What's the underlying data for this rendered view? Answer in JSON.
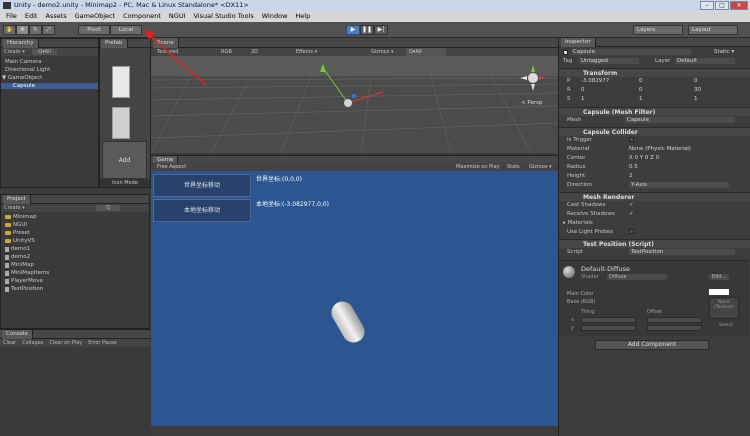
{
  "window": {
    "title": "Unity - demo2.unity - Minimap2 - PC, Mac & Linux Standalone* <DX11>",
    "minimize": "–",
    "maximize": "□",
    "close": "✕"
  },
  "menu": [
    "File",
    "Edit",
    "Assets",
    "GameObject",
    "Component",
    "NGUI",
    "Visual Studio Tools",
    "Window",
    "Help"
  ],
  "toolbar": {
    "pivot": "Pivot",
    "local": "Local",
    "play": "▶",
    "pause": "❚❚",
    "step": "▶|",
    "layers": "Layers",
    "layout": "Layout"
  },
  "hierarchy": {
    "tab": "Hierarchy",
    "create": "Create ▾",
    "search": "Q▾All",
    "items": [
      "Main Camera",
      "Directional Light",
      "▼ GameObject",
      "Capsule"
    ]
  },
  "prefab": {
    "tab": "Prefab",
    "add": "Add",
    "mode": "Icon Mode"
  },
  "scene": {
    "tab": "Scene",
    "shading": "Textured",
    "rgb": "RGB",
    "mode_2d": "2D",
    "effects": "Effects ▾",
    "gizmos": "Gizmos ▾",
    "search": "Q▾All",
    "persp": "< Persp"
  },
  "game": {
    "tab": "Game",
    "aspect": "Free Aspect",
    "max_on_play": "Maximize on Play",
    "stats": "Stats",
    "gizmos": "Gizmos ▾",
    "btn_world": "世界坐标移动",
    "btn_local": "本地坐标移动",
    "text_world": "世界坐标:(0,0,0)",
    "text_local": "本地坐标:(-3.082977,0,0)"
  },
  "project": {
    "tab": "Project",
    "create": "Create ▾",
    "search": "Q",
    "folders": [
      "Minimap",
      "NGUI",
      "Preset",
      "UnityVS"
    ],
    "files": [
      "demo1",
      "demo2",
      "MiniMap",
      "MiniMapItems",
      "PlayerMove",
      "TestPosition"
    ]
  },
  "console": {
    "tab": "Console",
    "clear": "Clear",
    "collapse": "Collapse",
    "clear_on_play": "Clear on Play",
    "error_pause": "Error Pause"
  },
  "inspector": {
    "tab": "Inspector",
    "name": "Capsule",
    "static": "Static ▾",
    "tag_label": "Tag",
    "tag": "Untagged",
    "layer_label": "Layer",
    "layer": "Default",
    "transform": {
      "title": "Transform",
      "position": {
        "label": "P",
        "x": "-3.082977",
        "y": "0",
        "z": "0"
      },
      "rotation": {
        "label": "R",
        "x": "0",
        "y": "0",
        "z": "30"
      },
      "scale": {
        "label": "S",
        "x": "1",
        "y": "1",
        "z": "1"
      }
    },
    "mesh_filter": {
      "title": "Capsule (Mesh Filter)",
      "mesh_label": "Mesh",
      "mesh": "Capsule"
    },
    "collider": {
      "title": "Capsule Collider",
      "rows": [
        {
          "label": "Is Trigger",
          "value": ""
        },
        {
          "label": "Material",
          "value": "None (Physic Material)"
        },
        {
          "label": "Center",
          "value": "X 0     Y 0     Z 0"
        },
        {
          "label": "Radius",
          "value": "0.5"
        },
        {
          "label": "Height",
          "value": "2"
        },
        {
          "label": "Direction",
          "value": "Y-Axis"
        }
      ]
    },
    "renderer": {
      "title": "Mesh Renderer",
      "rows": [
        {
          "label": "Cast Shadows",
          "value": "✓"
        },
        {
          "label": "Receive Shadows",
          "value": "✓"
        },
        {
          "label": "▸ Materials",
          "value": ""
        },
        {
          "label": "Use Light Probes",
          "value": ""
        }
      ]
    },
    "script": {
      "title": "Test Position (Script)",
      "label": "Script",
      "value": "TestPosition"
    },
    "material": {
      "name": "Default-Diffuse",
      "shader_label": "Shader",
      "shader": "Diffuse",
      "edit": "Edit...",
      "main_color": "Main Color",
      "base": "Base (RGB)",
      "tiling": "Tiling",
      "offset": "Offset",
      "x": "x",
      "y": "y",
      "none": "None\n(Texture)",
      "select": "Select"
    },
    "add_component": "Add Component"
  },
  "colors": {
    "accent": "#3e5f96",
    "game_bg": "#2b5690",
    "annotation": "#e02020"
  }
}
